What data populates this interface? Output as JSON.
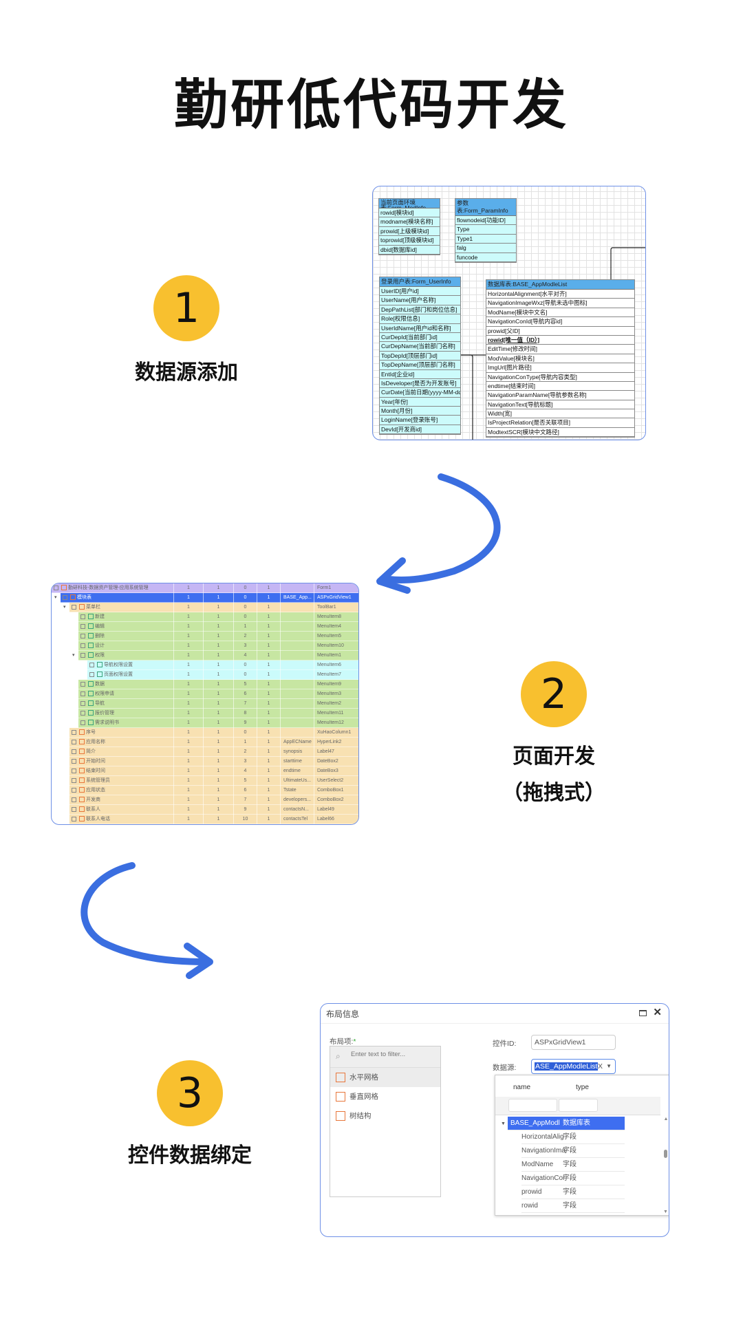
{
  "title": "勤研低代码开发",
  "steps": [
    {
      "number": "1",
      "label": "数据源添加"
    },
    {
      "number": "2",
      "label": "页面开发",
      "sublabel": "（拖拽式）"
    },
    {
      "number": "3",
      "label": "控件数据绑定"
    }
  ],
  "colors": {
    "accent_yellow": "#f8c02f",
    "arrow_blue": "#3a6ee0",
    "table_header": "#5aaeea",
    "table_row": "#ccfbfb",
    "grid_selected": "#3e6ef0"
  },
  "diagram": {
    "tables": [
      {
        "header": "当前页面环境表:Form_ModInfo",
        "rows": [
          "rowid[模块id]",
          "modname[模块名称]",
          "prowid[上级模块id]",
          "toprowid[顶级模块id]",
          "dbid[数据库id]"
        ]
      },
      {
        "header": "参数表:Form_ParamInfo",
        "rows": [
          "flownodeid[功能ID]",
          "Type",
          "Type1",
          "falg",
          "funcode"
        ]
      },
      {
        "header": "登录用户表:Form_UserInfo",
        "rows": [
          "UserID[用户id]",
          "UserName[用户名称]",
          "DepPathList[部门和岗位信息]",
          "Role[权限信息]",
          "UserIdName[用户id和名称]",
          "CurDepId[当前部门id]",
          "CurDepName[当前部门名称]",
          "TopDepId[顶层部门id]",
          "TopDepName[顶层部门名称]",
          "EntId[企业id]",
          "IsDeveloper[是否为开发账号]",
          "CurDate[当前日期(yyyy-MM-dd)]",
          "Year[年份]",
          "Month[月份]",
          "LoginName[登录账号]",
          "DevId[开发商id]"
        ]
      },
      {
        "header": "数据库表:BASE_AppModleList",
        "rows": [
          "HorizontalAlignment[水平对齐]",
          "NavigationImageWxz[导航未选中图标]",
          "ModName[模块中文名]",
          "NavigationConId[导航内容id]",
          "prowid[父ID]",
          "rowid[唯一值（ID）]",
          "EditTime[修改时间]",
          "ModValue[模块名]",
          "ImgUrl[图片路径]",
          "NavigationConType[导航内容类型]",
          "endtime[结束时间]",
          "NavigationParamName[导航参数名称]",
          "NavigationText[导航标题]",
          "Width[宽]",
          "IsProjectRelation[是否关联项目]",
          "ModtextSCR[模块中文路径]"
        ]
      }
    ]
  },
  "grid": {
    "rows": [
      {
        "level": 0,
        "label": "勤研科技-数据资产管理-应用系统管理",
        "c1": "1",
        "c2": "1",
        "c3": "0",
        "c4": "1",
        "field": "",
        "control": "Form1",
        "tone": "purple"
      },
      {
        "level": 1,
        "label": "模块表",
        "c1": "1",
        "c2": "1",
        "c3": "0",
        "c4": "1",
        "field": "BASE_App...",
        "control": "ASPxGridView1",
        "tone": "selected",
        "expand": true
      },
      {
        "level": 2,
        "label": "菜单栏",
        "c1": "1",
        "c2": "1",
        "c3": "0",
        "c4": "1",
        "field": "",
        "control": "ToolBar1",
        "tone": "orange",
        "expand": true
      },
      {
        "level": 3,
        "label": "新建",
        "c1": "1",
        "c2": "1",
        "c3": "0",
        "c4": "1",
        "field": "",
        "control": "MenuItem8",
        "tone": "green"
      },
      {
        "level": 3,
        "label": "编辑",
        "c1": "1",
        "c2": "1",
        "c3": "1",
        "c4": "1",
        "field": "",
        "control": "MenuItem4",
        "tone": "green"
      },
      {
        "level": 3,
        "label": "删除",
        "c1": "1",
        "c2": "1",
        "c3": "2",
        "c4": "1",
        "field": "",
        "control": "MenuItem5",
        "tone": "green"
      },
      {
        "level": 3,
        "label": "设计",
        "c1": "1",
        "c2": "1",
        "c3": "3",
        "c4": "1",
        "field": "",
        "control": "MenuItem10",
        "tone": "green"
      },
      {
        "level": 3,
        "label": "权限",
        "c1": "1",
        "c2": "1",
        "c3": "4",
        "c4": "1",
        "field": "",
        "control": "MenuItem1",
        "tone": "green",
        "expand": true
      },
      {
        "level": 4,
        "label": "导航权限设置",
        "c1": "1",
        "c2": "1",
        "c3": "0",
        "c4": "1",
        "field": "",
        "control": "MenuItem6",
        "tone": "cyan"
      },
      {
        "level": 4,
        "label": "页面权限设置",
        "c1": "1",
        "c2": "1",
        "c3": "0",
        "c4": "1",
        "field": "",
        "control": "MenuItem7",
        "tone": "cyan"
      },
      {
        "level": 3,
        "label": "数据",
        "c1": "1",
        "c2": "1",
        "c3": "5",
        "c4": "1",
        "field": "",
        "control": "MenuItem9",
        "tone": "green"
      },
      {
        "level": 3,
        "label": "权限申请",
        "c1": "1",
        "c2": "1",
        "c3": "6",
        "c4": "1",
        "field": "",
        "control": "MenuItem3",
        "tone": "green"
      },
      {
        "level": 3,
        "label": "导航",
        "c1": "1",
        "c2": "1",
        "c3": "7",
        "c4": "1",
        "field": "",
        "control": "MenuItem2",
        "tone": "green"
      },
      {
        "level": 3,
        "label": "报价管理",
        "c1": "1",
        "c2": "1",
        "c3": "8",
        "c4": "1",
        "field": "",
        "control": "MenuItem11",
        "tone": "green"
      },
      {
        "level": 3,
        "label": "需求说明书",
        "c1": "1",
        "c2": "1",
        "c3": "9",
        "c4": "1",
        "field": "",
        "control": "MenuItem12",
        "tone": "green"
      },
      {
        "level": 2,
        "label": "序号",
        "c1": "1",
        "c2": "1",
        "c3": "0",
        "c4": "1",
        "field": "",
        "control": "XuHaoColumn1",
        "tone": "orange"
      },
      {
        "level": 2,
        "label": "应用名称",
        "c1": "1",
        "c2": "1",
        "c3": "1",
        "c4": "1",
        "field": "AppECName",
        "control": "HyperLink2",
        "tone": "orange"
      },
      {
        "level": 2,
        "label": "简介",
        "c1": "1",
        "c2": "1",
        "c3": "2",
        "c4": "1",
        "field": "synopsis",
        "control": "Label47",
        "tone": "orange"
      },
      {
        "level": 2,
        "label": "开始时间",
        "c1": "1",
        "c2": "1",
        "c3": "3",
        "c4": "1",
        "field": "starttime",
        "control": "DateBox2",
        "tone": "orange"
      },
      {
        "level": 2,
        "label": "结束时间",
        "c1": "1",
        "c2": "1",
        "c3": "4",
        "c4": "1",
        "field": "endtime",
        "control": "DateBox3",
        "tone": "orange"
      },
      {
        "level": 2,
        "label": "系统管理员",
        "c1": "1",
        "c2": "1",
        "c3": "5",
        "c4": "1",
        "field": "UltimateUs...",
        "control": "UserSelect2",
        "tone": "orange"
      },
      {
        "level": 2,
        "label": "应用状态",
        "c1": "1",
        "c2": "1",
        "c3": "6",
        "c4": "1",
        "field": "Tstate",
        "control": "ComboBox1",
        "tone": "orange"
      },
      {
        "level": 2,
        "label": "开发商",
        "c1": "1",
        "c2": "1",
        "c3": "7",
        "c4": "1",
        "field": "developers...",
        "control": "ComboBox2",
        "tone": "orange"
      },
      {
        "level": 2,
        "label": "联系人",
        "c1": "1",
        "c2": "1",
        "c3": "9",
        "c4": "1",
        "field": "contactsN...",
        "control": "Label49",
        "tone": "orange"
      },
      {
        "level": 2,
        "label": "联系人电话",
        "c1": "1",
        "c2": "1",
        "c3": "10",
        "c4": "1",
        "field": "contactsTel",
        "control": "Label66",
        "tone": "orange"
      }
    ]
  },
  "dialog": {
    "title": "布局信息",
    "layout_label": "布局项:",
    "required_mark": "*",
    "filter_placeholder": "Enter text to filter...",
    "layout_items": [
      {
        "label": "水平网格",
        "icon": "horizontal-grid-icon",
        "selected": true
      },
      {
        "label": "垂直网格",
        "icon": "vertical-grid-icon"
      },
      {
        "label": "树结构",
        "icon": "tree-icon"
      }
    ],
    "control_id_label": "控件ID:",
    "control_id_value": "ASPxGridView1",
    "datasource_label": "数据源:",
    "datasource_value": "ASE_AppModleList",
    "clear_label": "X",
    "popup": {
      "col_name": "name",
      "col_type": "type",
      "rows": [
        {
          "name": "BASE_AppModleLi:",
          "type": "数据库表",
          "selected": true
        },
        {
          "name": "HorizontalAlig",
          "type": "字段"
        },
        {
          "name": "NavigationIma",
          "type": "字段"
        },
        {
          "name": "ModName",
          "type": "字段"
        },
        {
          "name": "NavigationCor",
          "type": "字段"
        },
        {
          "name": "prowid",
          "type": "字段"
        },
        {
          "name": "rowid",
          "type": "字段"
        }
      ]
    }
  }
}
